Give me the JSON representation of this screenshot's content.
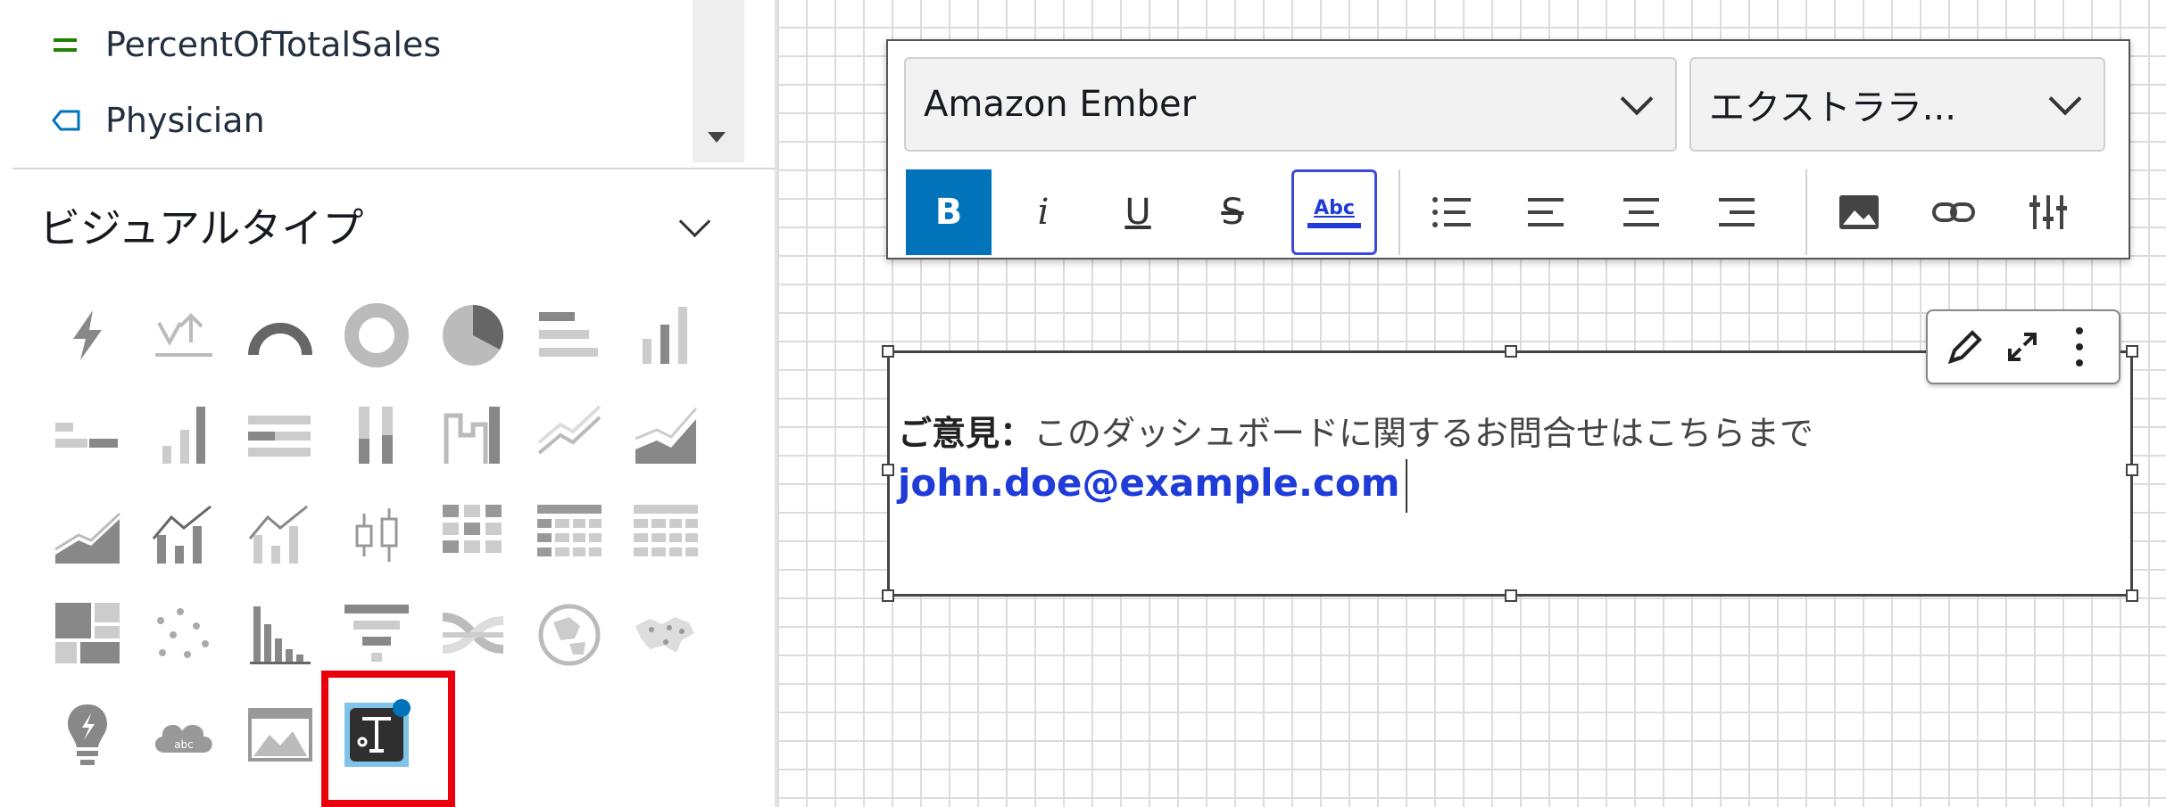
{
  "fields": [
    {
      "name": "PercentOfTotalSales",
      "icon": "measure-equals-icon",
      "icon_color": "#1d8102"
    },
    {
      "name": "Physician",
      "icon": "dimension-tag-icon",
      "icon_color": "#0073bb"
    }
  ],
  "visual_types": {
    "title": "ビジュアルタイプ",
    "icons": [
      "kpi-icon",
      "gauge-arrow-icon",
      "gauge-arc-icon",
      "donut-icon",
      "pie-icon",
      "horizontal-bar-icon",
      "vertical-bar-icon",
      "clustered-horizontal-bar-icon",
      "clustered-vertical-bar-icon",
      "stacked-horizontal-bar-icon",
      "stacked-vertical-bar-icon",
      "percent-vertical-bar-icon",
      "line-icon",
      "area-icon",
      "stacked-area-icon",
      "combo-bar-line-icon",
      "combo-stacked-icon",
      "box-plot-icon",
      "heatmap-icon",
      "pivot-table-icon",
      "table-icon",
      "treemap-icon",
      "scatter-icon",
      "histogram-icon",
      "funnel-icon",
      "sankey-icon",
      "filled-map-icon",
      "points-map-icon",
      "insight-icon",
      "word-cloud-icon",
      "custom-visual-icon",
      "text-box-icon"
    ],
    "selected": "text-box-icon",
    "highlight_color": "#e8000b"
  },
  "toolbar": {
    "font_family": "Amazon Ember",
    "font_size": "エクストララ...",
    "bold_label": "B",
    "italic_label": "i",
    "underline_label": "U",
    "strike_label": "S",
    "color_label": "Abc",
    "active_color": "#0073bb",
    "text_color": "#1f3bd8"
  },
  "textbox": {
    "label": "ご意見",
    "separator": "：",
    "message": "このダッシュボードに関するお問合せはこちらまで",
    "email": "john.doe@example.com"
  }
}
